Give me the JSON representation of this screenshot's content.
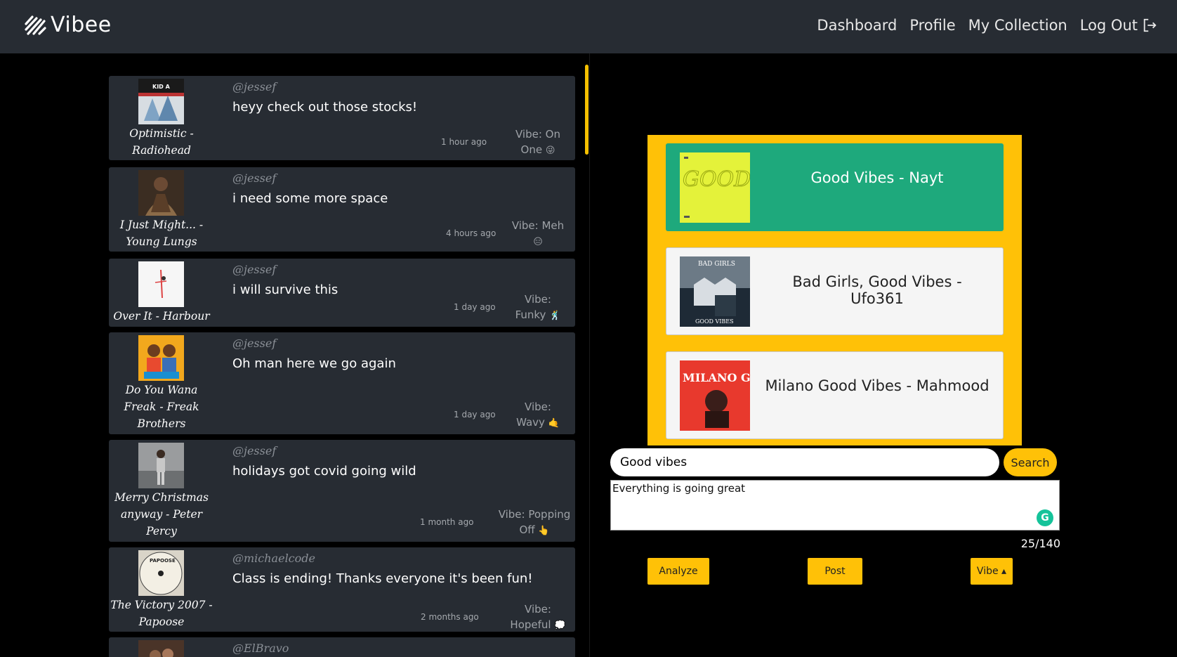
{
  "nav": {
    "brand": "Vibee",
    "links": {
      "dashboard": "Dashboard",
      "profile": "Profile",
      "collection": "My Collection",
      "logout": "Log Out"
    }
  },
  "posts": [
    {
      "user": "@jessef",
      "message": "heyy check out those stocks!",
      "song_line1": "Optimistic -",
      "song_line2": "Radiohead",
      "song_line3": "",
      "time": "1 hour ago",
      "vibe_line1": "Vibe: On",
      "vibe_line2": "One",
      "emoji": "😜"
    },
    {
      "user": "@jessef",
      "message": "i need some more space",
      "song_line1": "I Just Might... -",
      "song_line2": "Young Lungs",
      "song_line3": "",
      "time": "4 hours ago",
      "vibe_line1": "Vibe: Meh",
      "vibe_line2": "",
      "emoji": "😑"
    },
    {
      "user": "@jessef",
      "message": "i will survive this",
      "song_line1": "Over It - Harbour",
      "song_line2": "",
      "song_line3": "",
      "time": "1 day ago",
      "vibe_line1": "Vibe:",
      "vibe_line2": "Funky",
      "emoji": "🕺"
    },
    {
      "user": "@jessef",
      "message": "Oh man here we go again",
      "song_line1": "Do You Wana",
      "song_line2": "Freak - Freak",
      "song_line3": "Brothers",
      "time": "1 day ago",
      "vibe_line1": "Vibe:",
      "vibe_line2": "Wavy",
      "emoji": "🤙"
    },
    {
      "user": "@jessef",
      "message": "holidays got covid going wild",
      "song_line1": "Merry Christmas",
      "song_line2": "anyway - Peter",
      "song_line3": "Percy",
      "time": "1 month ago",
      "vibe_line1": "Vibe: Popping",
      "vibe_line2": "Off",
      "emoji": "👆"
    },
    {
      "user": "@michaelcode",
      "message": "Class is ending! Thanks everyone it's been fun!",
      "song_line1": "The Victory 2007 -",
      "song_line2": "Papoose",
      "song_line3": "",
      "time": "2 months ago",
      "vibe_line1": "Vibe:",
      "vibe_line2": "Hopeful",
      "emoji": "💭"
    },
    {
      "user": "@ElBravo",
      "message": "",
      "song_line1": "",
      "song_line2": "",
      "song_line3": "",
      "time": "",
      "vibe_line1": "",
      "vibe_line2": "",
      "emoji": ""
    }
  ],
  "results": [
    {
      "title": "Good Vibes - Nayt",
      "selected": true
    },
    {
      "title": "Bad Girls, Good Vibes - Ufo361",
      "selected": false
    },
    {
      "title": "Milano Good Vibes - Mahmood",
      "selected": false
    }
  ],
  "cover_art": {
    "kid_a": "KID A",
    "good_vibes": "GOOD VIBES",
    "bad_girls_top": "BAD GIRLS",
    "bad_girls_bottom": "GOOD VIBES",
    "milano": "MILANO GOOD VIBES",
    "papoose": "PAPOOSE"
  },
  "search": {
    "value": "Good vibes",
    "button": "Search"
  },
  "compose": {
    "text": "Everything is going great",
    "counter": "25/140",
    "grammarly": "G"
  },
  "actions": {
    "analyze": "Analyze",
    "post": "Post",
    "vibe": "Vibe ▴"
  },
  "colors": {
    "accent": "#ffc107",
    "selected": "#1ea97c",
    "navbar": "#272c33",
    "card": "#272c33"
  }
}
